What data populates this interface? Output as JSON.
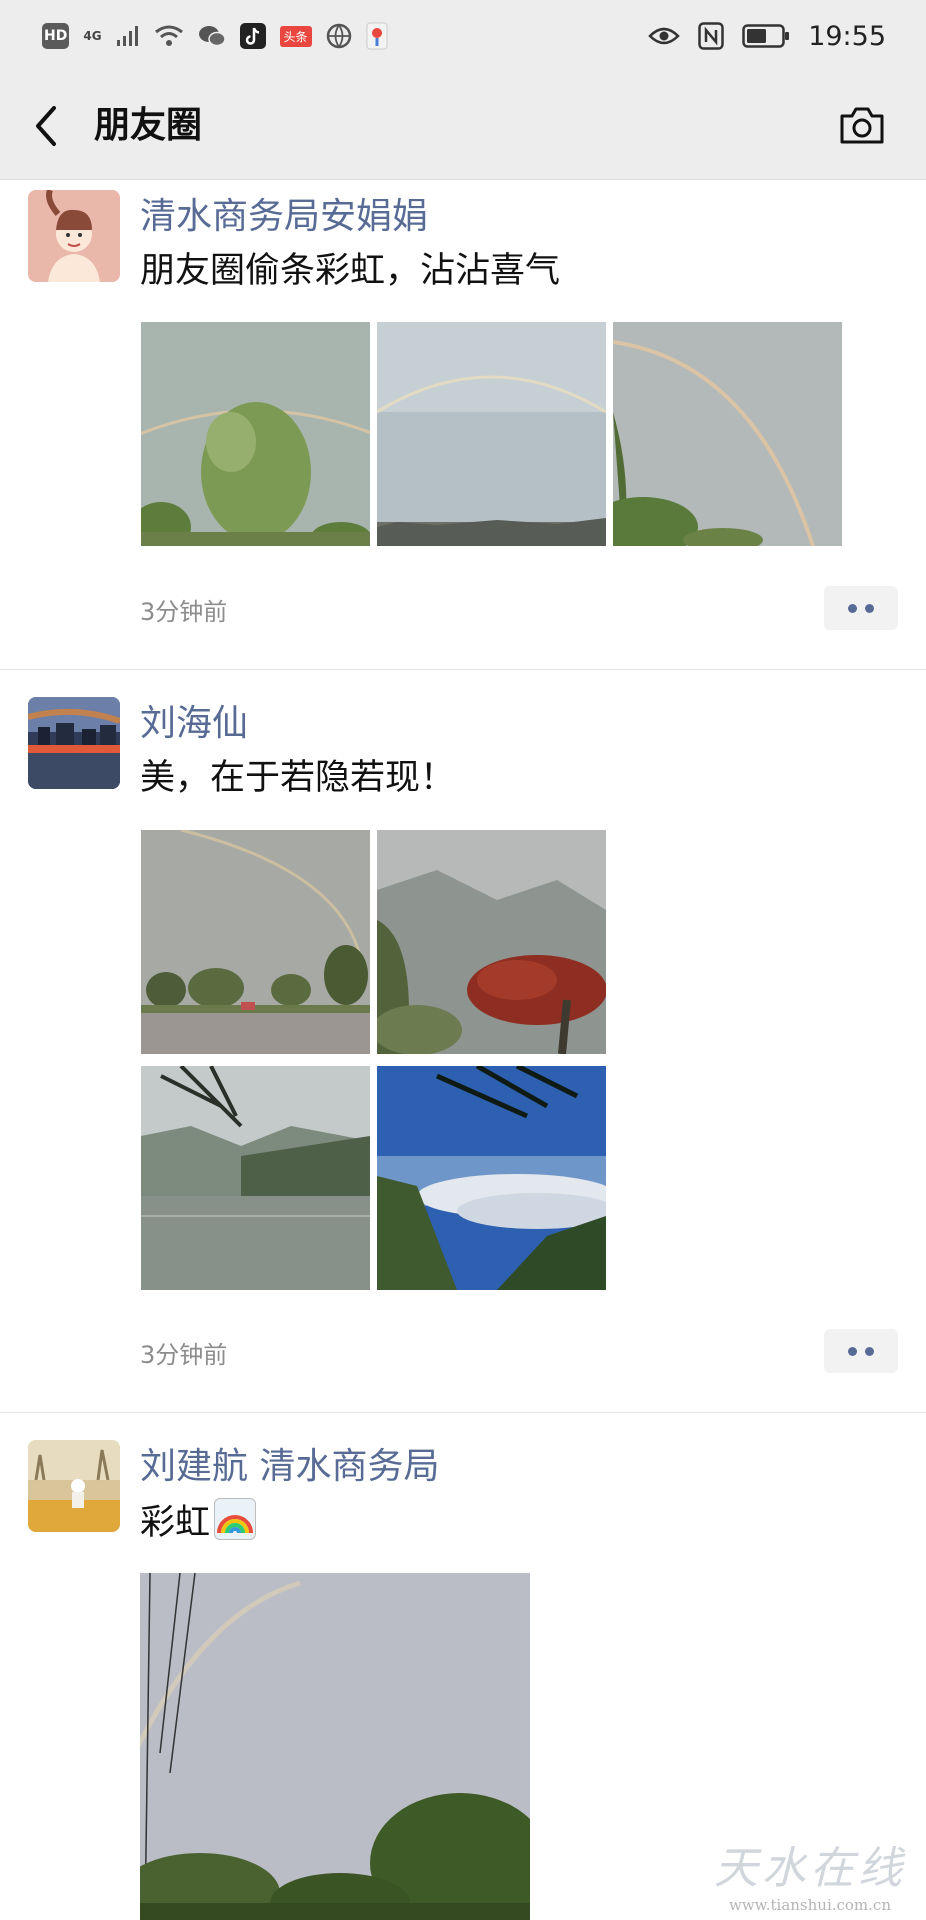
{
  "status_bar": {
    "hd": "HD",
    "network": "4G",
    "toutiao": "头条",
    "time": "19:55"
  },
  "nav": {
    "title": "朋友圈"
  },
  "posts": [
    {
      "author": "清水商务局安娟娟",
      "text": "朋友圈偷条彩虹，沾沾喜气",
      "time": "3分钟前"
    },
    {
      "author": "刘海仙",
      "text": "美，在于若隐若现！",
      "time": "3分钟前"
    },
    {
      "author": "刘建航  清水商务局",
      "text": "彩虹"
    }
  ],
  "watermark": {
    "main": "天水在线",
    "url": "www.tianshui.com.cn"
  },
  "colors": {
    "link": "#576b95",
    "bar": "#ededed"
  }
}
